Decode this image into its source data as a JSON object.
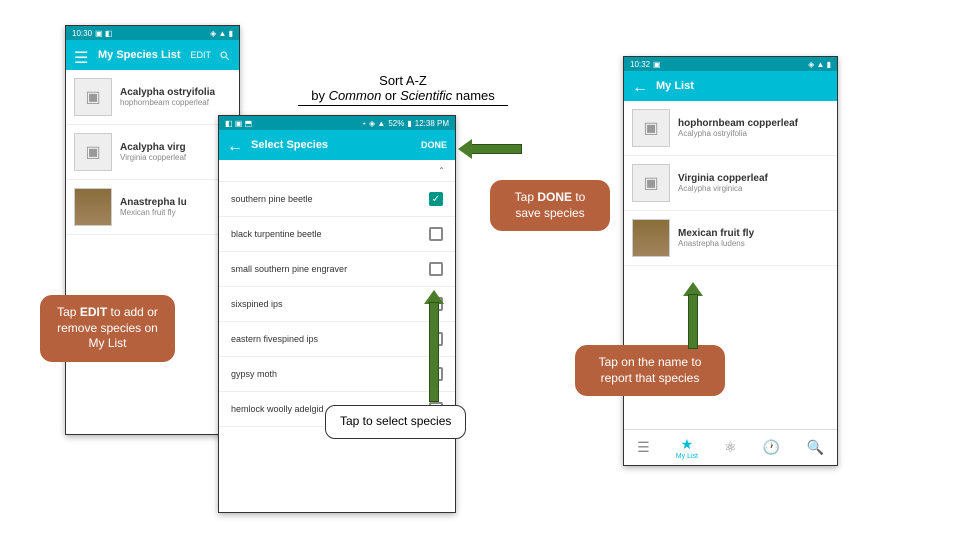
{
  "annotation": {
    "sort_line1": "Sort A-Z",
    "sort_line2a": "by ",
    "sort_line2b": "Common",
    "sort_line2c": " or ",
    "sort_line2d": "Scientific ",
    "sort_line2e": "names"
  },
  "callouts": {
    "edit1": "Tap ",
    "edit2": "EDIT",
    "edit3": " to add or remove species on My List",
    "done1": "Tap ",
    "done2": "DONE",
    "done3": " to save species",
    "tap_name": "Tap on the name to report that species",
    "tap_select": "Tap to select species"
  },
  "phone1": {
    "time": "10:30",
    "title": "My Species List",
    "edit": "EDIT",
    "items": [
      {
        "title": "Acalypha ostryifolia",
        "sub": "hophornbeam copperleaf"
      },
      {
        "title": "Acalypha virg",
        "sub": "Virginia copperleaf"
      },
      {
        "title": "Anastrepha lu",
        "sub": "Mexican fruit fly"
      }
    ]
  },
  "phone2": {
    "time": "12:38 PM",
    "battery": "52%",
    "title": "Select Species",
    "done": "DONE",
    "sort_label": "",
    "items": [
      {
        "name": "southern pine beetle",
        "checked": true
      },
      {
        "name": "black turpentine beetle",
        "checked": false
      },
      {
        "name": "small southern pine engraver",
        "checked": false
      },
      {
        "name": "sixspined ips",
        "checked": false
      },
      {
        "name": "eastern fivespined ips",
        "checked": false
      },
      {
        "name": "gypsy moth",
        "checked": false
      },
      {
        "name": "hemlock woolly adelgid",
        "checked": false
      }
    ]
  },
  "phone3": {
    "time": "10:32",
    "title": "My List",
    "items": [
      {
        "title": "hophornbeam copperleaf",
        "sub": "Acalypha ostryifolia"
      },
      {
        "title": "Virginia copperleaf",
        "sub": "Acalypha virginica"
      },
      {
        "title": "Mexican fruit fly",
        "sub": "Anastrepha ludens"
      }
    ],
    "nav": {
      "mylist": "My List"
    }
  }
}
